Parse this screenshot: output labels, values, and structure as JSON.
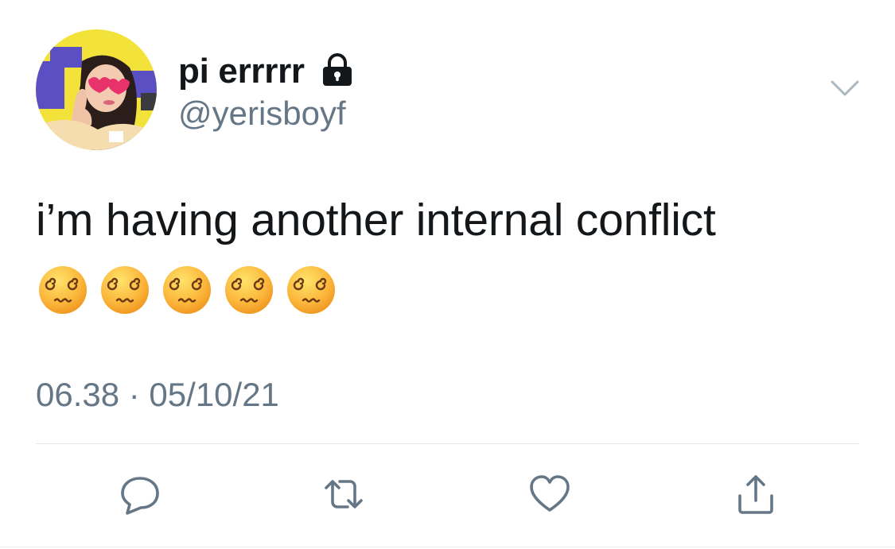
{
  "tweet": {
    "display_name": "pi errrrr",
    "handle": "@yerisboyf",
    "text": "i’m having another internal conflict",
    "emojis": [
      "😵‍💫",
      "😵‍💫",
      "😵‍💫",
      "😵‍💫",
      "😵‍💫"
    ],
    "timestamp": "06.38 · 05/10/21",
    "protected_icon": "lock-icon",
    "menu_icon": "chevron-down-icon"
  },
  "actions": [
    {
      "name": "reply",
      "icon": "comment-icon"
    },
    {
      "name": "retweet",
      "icon": "retweet-icon"
    },
    {
      "name": "like",
      "icon": "heart-icon"
    },
    {
      "name": "share",
      "icon": "share-icon"
    }
  ],
  "colors": {
    "text_primary": "#14171a",
    "text_secondary": "#657786",
    "icon_gray": "#657786",
    "divider": "#e1e8ed",
    "avatar_bg": "#f2e23a",
    "avatar_accent": "#5b4fc4"
  }
}
